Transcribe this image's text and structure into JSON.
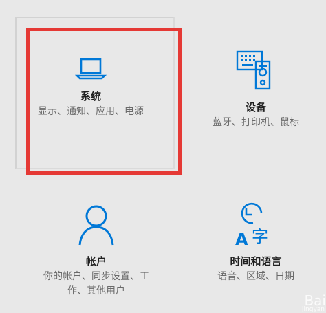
{
  "tiles": {
    "system": {
      "title": "系统",
      "desc": "显示、通知、应用、电源",
      "icon": "laptop-icon"
    },
    "devices": {
      "title": "设备",
      "desc": "蓝牙、打印机、鼠标",
      "icon": "devices-icon"
    },
    "accounts": {
      "title": "帐户",
      "desc": "你的帐户、同步设置、工作、其他用户",
      "icon": "person-icon"
    },
    "time": {
      "title": "时间和语言",
      "desc": "语音、区域、日期",
      "icon": "time-language-icon",
      "glyph": "字"
    }
  },
  "watermark": {
    "text": "Bai",
    "sub": "jingyan"
  },
  "colors": {
    "accent": "#0078d7",
    "highlight": "#e53935",
    "background": "#e8e8e8"
  }
}
